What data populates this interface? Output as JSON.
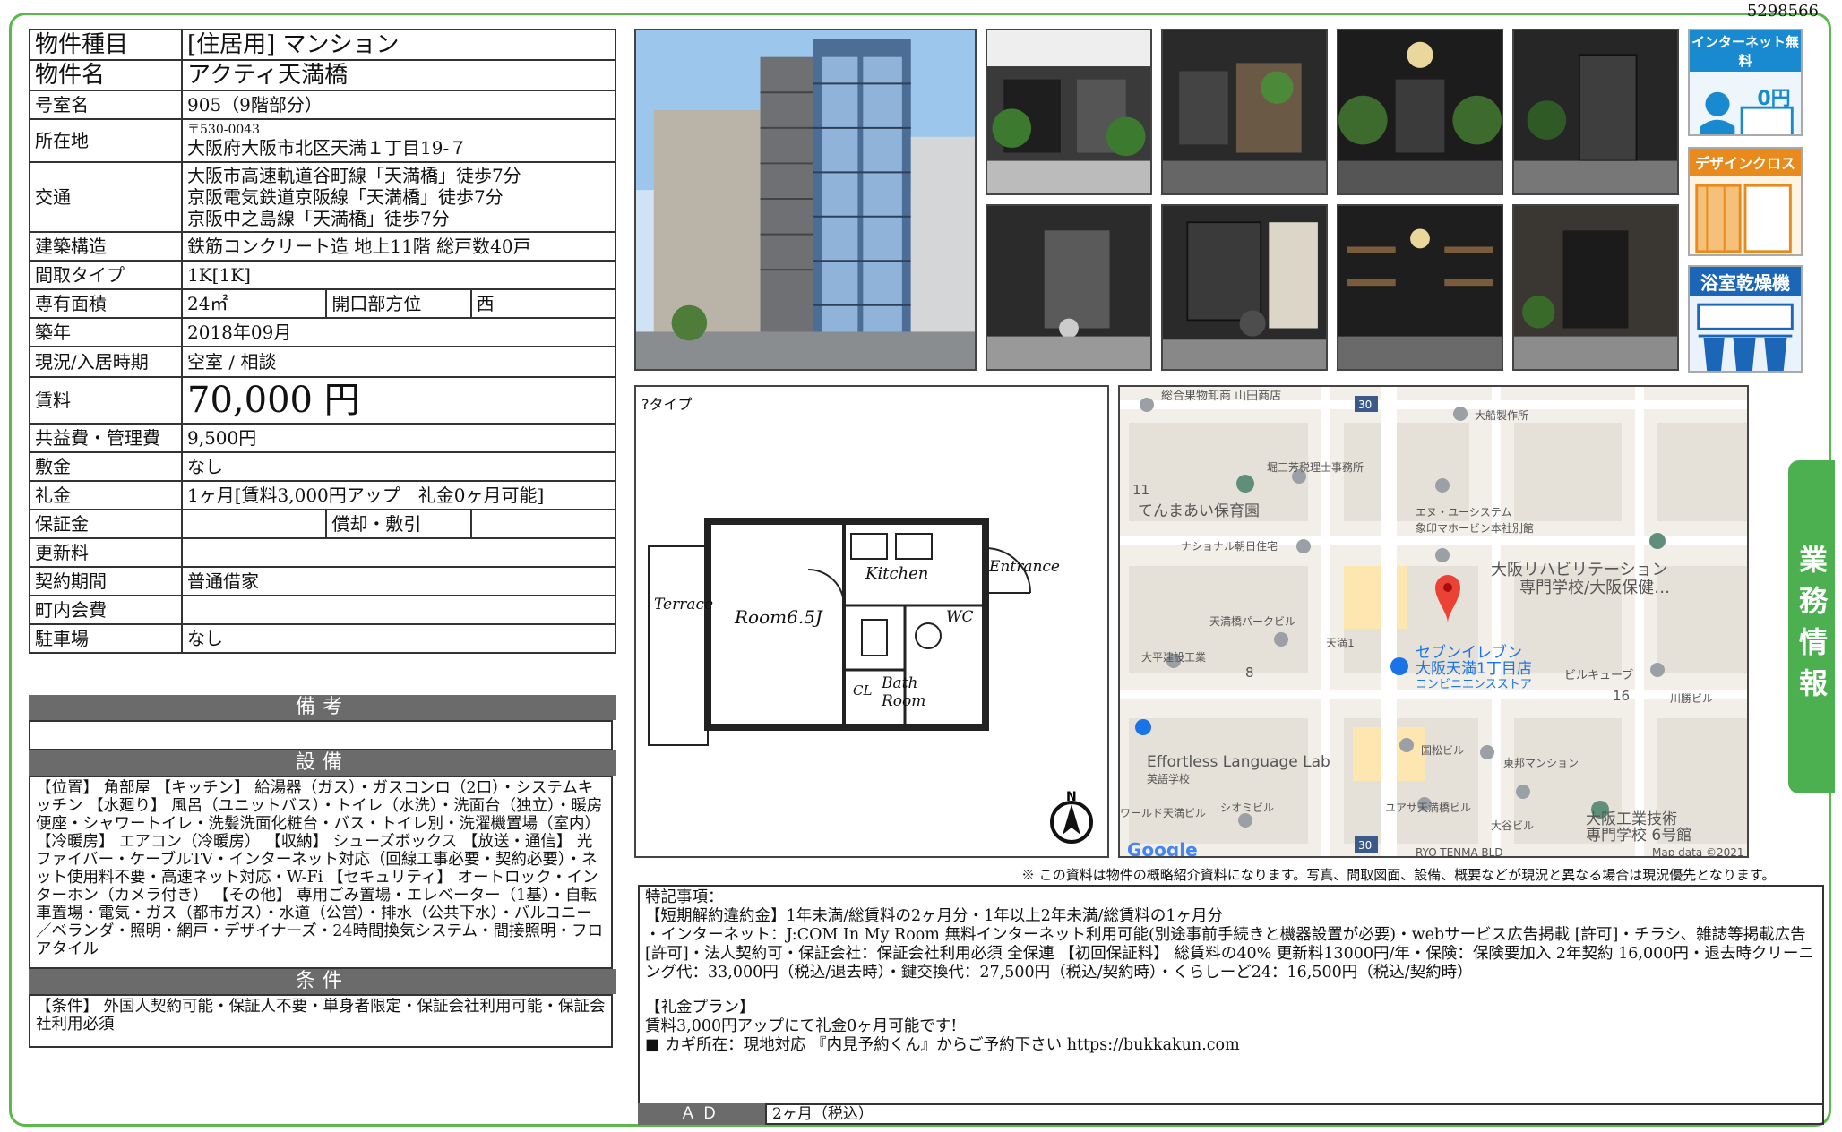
{
  "doc_id": "5298566",
  "property": {
    "type_label": "物件種目",
    "type_value": "[住居用]  マンション",
    "name_label": "物件名",
    "name_value": "アクティ天満橋",
    "room_label": "号室名",
    "room_value": "905（9階部分）",
    "address_label": "所在地",
    "postal": "〒530-0043",
    "address": "大阪府大阪市北区天満１丁目19-７",
    "transport_label": "交通",
    "transport": [
      "大阪市高速軌道谷町線「天満橋」徒歩7分",
      "京阪電気鉄道京阪線「天満橋」徒歩7分",
      "京阪中之島線「天満橋」徒歩7分"
    ],
    "structure_label": "建築構造",
    "structure_value": "鉄筋コンクリート造  地上11階  総戸数40戸",
    "layout_label": "間取タイプ",
    "layout_value": "1K[1K]",
    "area_label": "専有面積",
    "area_value": "24㎡",
    "direction_label": "開口部方位",
    "direction_value": "西",
    "built_label": "築年",
    "built_value": "2018年09月",
    "status_label": "現況/入居時期",
    "status_value": "空室  /  相談",
    "rent_label": "賃料",
    "rent_value": "70,000 円",
    "fee_label": "共益費・管理費",
    "fee_value": "9,500円",
    "deposit_label": "敷金",
    "deposit_value": "なし",
    "keymoney_label": "礼金",
    "keymoney_value": "1ヶ月[賃料3,000円アップ　礼金0ヶ月可能]",
    "guarantee_label": "保証金",
    "guarantee_value": "",
    "amort_label": "償却・敷引",
    "amort_value": "",
    "renewal_label": "更新料",
    "renewal_value": "",
    "contract_label": "契約期間",
    "contract_value": "普通借家",
    "community_label": "町内会費",
    "community_value": "",
    "parking_label": "駐車場",
    "parking_value": "なし"
  },
  "sections": {
    "remarks_title": "備考",
    "remarks_text": "",
    "equipment_title": "設備",
    "equipment_text": "【位置】 角部屋 【キッチン】 給湯器（ガス）・ガスコンロ（2口）・システムキッチン 【水廻り】 風呂（ユニットバス）・トイレ（水洗）・洗面台（独立）・暖房便座・シャワートイレ・洗髪洗面化粧台・バス・トイレ別・洗濯機置場（室内） 【冷暖房】 エアコン（冷暖房） 【収納】 シューズボックス 【放送・通信】 光ファイバー・ケーブルTV・インターネット対応（回線工事必要・契約必要）・ネット使用料不要・高速ネット対応・W-Fi 【セキュリティ】 オートロック・インターホン（カメラ付き） 【その他】 専用ごみ置場・エレベーター（1基）・自転車置場・電気・ガス（都市ガス）・水道（公営）・排水（公共下水）・バルコニー／ベランダ・照明・網戸・デザイナーズ・24時間換気システム・間接照明・フロアタイル",
    "conditions_title": "条件",
    "conditions_text": "【条件】 外国人契約可能・保証人不要・単身者限定・保証会社利用可能・保証会社利用必須"
  },
  "badges": {
    "internet": {
      "line1": "インターネット無料",
      "line2": "0円"
    },
    "design": {
      "line1": "デザインクロス"
    },
    "bath": {
      "line1": "浴室乾燥機"
    }
  },
  "sidebar_label": "業務情報",
  "floorplan": {
    "caption": "?タイプ",
    "labels": {
      "kitchen": "Kitchen",
      "entrance": "Entrance",
      "terrace": "Terrace",
      "room": "Room6.5J",
      "wc": "WC",
      "cl": "CL",
      "bath": "Bath",
      "bath2": "Room"
    },
    "north": "N"
  },
  "map": {
    "labels": [
      "総合果物卸商 山田商店",
      "大船製作所",
      "堀三芳税理士事務所",
      "てんまあい保育園",
      "エヌ・ユーシステム",
      "象印マホービン本社別館",
      "ナショナル朝日住宅",
      "大阪リハビリテーション",
      "専門学校/大阪保健…",
      "天満橋パークビル",
      "天満1",
      "大平建設工業",
      "セブンイレブン",
      "大阪天満1丁目店",
      "コンビニエンスストア",
      "ビルキューブ",
      "川勝ビル",
      "Effortless Language Lab",
      "英語学校",
      "国松ビル",
      "東邦マンション",
      "ワールド天満ビル",
      "シオミビル",
      "ユアサ天満橋ビル",
      "大谷ビル",
      "大阪工業技術",
      "専門学校 6号館",
      "RYO-TENMA-BLD",
      "Map data ©2021",
      "Google"
    ],
    "numbers": [
      "30",
      "11",
      "8",
      "16",
      "30"
    ]
  },
  "disclaimer": "※ この資料は物件の概略紹介資料になります。写真、間取図面、設備、概要などが現況と異なる場合は現況優先となります。",
  "notes": {
    "title": "特記事項：",
    "line1": "【短期解約違約金】1年未満/総賃料の2ヶ月分・1年以上2年未満/総賃料の1ヶ月分",
    "line2": "・インターネット：J:COM In My Room 無料インターネット利用可能(別途事前手続きと機器設置が必要)・webサービス広告掲載 [許可]・チラシ、雑誌等掲載広告 [許可]・法人契約可・保証会社：保証会社利用必須 全保連 【初回保証料】 総賃料の40% 更新料13000円/年・保険：保険要加入 2年契約 16,000円・退去時クリーニング代：33,000円（税込/退去時）・鍵交換代：27,500円（税込/契約時）・くらしーど24：16,500円（税込/契約時）",
    "plan_title": "【礼金プラン】",
    "plan_text": "賃料3,000円アップにて礼金0ヶ月可能です!",
    "key_text": "■ カギ所在：現地対応  『内見予約くん』からご予約下さい  https://bukkakun.com"
  },
  "ad": {
    "label": "ＡＤ",
    "value": "2ヶ月（税込）"
  }
}
